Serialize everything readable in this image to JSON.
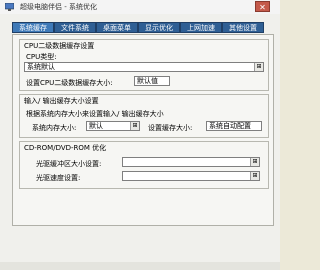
{
  "window": {
    "title": "超级电脑伴侣 - 系统优化",
    "close_symbol": "✕"
  },
  "tabs": [
    "系统缓存",
    "文件系统",
    "桌面菜单",
    "显示优化",
    "上网加速",
    "其他设置"
  ],
  "active_tab": 0,
  "cpu_group": {
    "title": "CPU二级数据缓存设置",
    "cpu_type_label": "CPU类型:",
    "cpu_type_value": "系统默认",
    "cache_label": "设置CPU二级数据缓存大小:",
    "cache_value": "默认值"
  },
  "io_group": {
    "title": "输入/ 输出缓存大小设置",
    "description": "根据系统内存大小来设置输入/ 输出缓存大小",
    "memory_label": "系统内存大小:",
    "memory_value": "默认",
    "buffer_label": "设置缓存大小:",
    "buffer_value": "系统自动配置"
  },
  "cdrom_group": {
    "title": "CD-ROM/DVD-ROM 优化",
    "buffer_label": "光驱缓冲区大小设置:",
    "buffer_value": "",
    "speed_label": "光驱速度设置:",
    "speed_value": ""
  },
  "dropdown_symbol": "⊞",
  "colors": {
    "tab_bg": "#2f5f94",
    "tab_active_bg": "#3f7ab8",
    "close_bg": "#c45a4a"
  }
}
